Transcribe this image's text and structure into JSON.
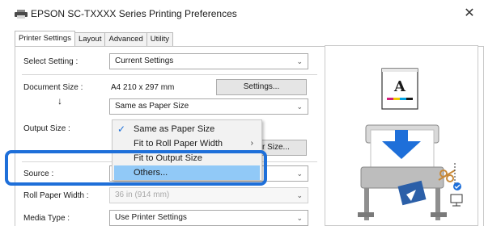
{
  "window": {
    "title": "EPSON SC-TXXXX Series Printing Preferences",
    "close_glyph": "✕"
  },
  "tabs": [
    {
      "label": "Printer Settings",
      "active": true
    },
    {
      "label": "Layout",
      "active": false
    },
    {
      "label": "Advanced",
      "active": false
    },
    {
      "label": "Utility",
      "active": false
    }
  ],
  "form": {
    "select_setting_label": "Select Setting :",
    "select_setting_value": "Current Settings",
    "document_size_label": "Document Size :",
    "document_size_value": "A4 210 x 297 mm",
    "settings_button": "Settings...",
    "down_arrow": "↓",
    "same_as_paper_value": "Same as Paper Size",
    "output_size_label": "Output Size :",
    "size_button_partial": "r Size...",
    "source_label": "Source :",
    "roll_paper_width_label": "Roll Paper Width :",
    "roll_paper_width_value": "36 in (914 mm)",
    "media_type_label": "Media Type :",
    "media_type_value": "Use Printer Settings"
  },
  "menu": {
    "items": [
      {
        "label": "Same as Paper Size",
        "checked": true
      },
      {
        "label": "Fit to Roll Paper Width",
        "submenu": true
      },
      {
        "label": "Fit to Output Size"
      },
      {
        "label": "Others...",
        "highlighted": true
      }
    ]
  },
  "preview": {
    "page_letter": "A",
    "icons": [
      "printer-icon",
      "scissors-icon",
      "network-computer-icon"
    ]
  },
  "colors": {
    "accent": "#1e6fd9",
    "highlight": "#91c9f7",
    "disabled_text": "#a8a8a8"
  }
}
